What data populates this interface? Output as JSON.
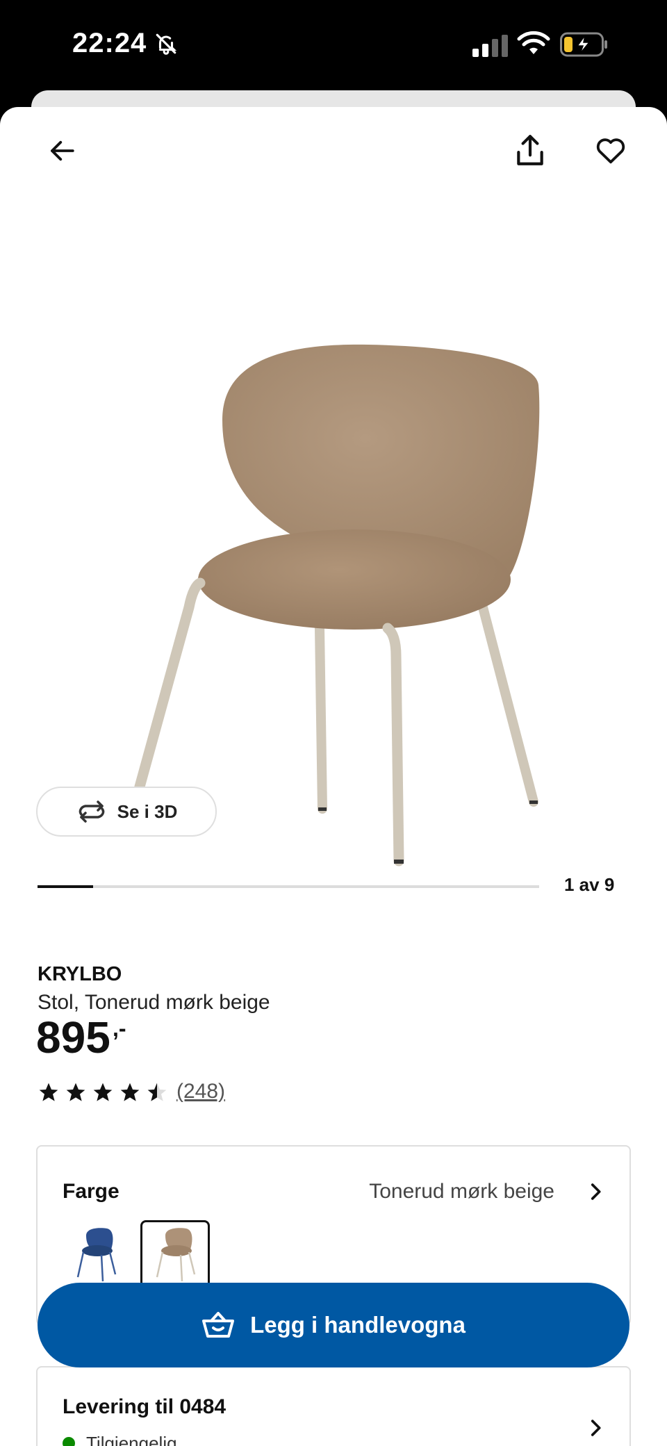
{
  "status_bar": {
    "time": "22:24",
    "icons": [
      "bell-slash-icon",
      "cellular-signal-icon",
      "wifi-icon",
      "battery-charging-icon"
    ]
  },
  "nav": {
    "icons": [
      "back-arrow-icon",
      "share-icon",
      "heart-icon"
    ]
  },
  "gallery": {
    "view_3d_label": "Se i 3D",
    "counter": "1 av 9",
    "progress_fraction": 0.111,
    "image": "chair-image"
  },
  "product": {
    "name": "KRYLBO",
    "description": "Stol, Tonerud mørk beige",
    "price": "895",
    "price_suffix": ",-",
    "rating": 4.5,
    "review_count": "(248)"
  },
  "color_selector": {
    "label": "Farge",
    "selected_value": "Tonerud mørk beige",
    "swatches": [
      "blue",
      "beige"
    ]
  },
  "cart": {
    "button_label": "Legg i handlevogna"
  },
  "delivery": {
    "title": "Levering til 0484",
    "status": "Tilgjengelig"
  },
  "colors": {
    "brand_blue": "#0058a3",
    "available_green": "#0a8a00",
    "chair_fabric": "#a98e74",
    "chair_legs": "#cfc7b8"
  }
}
